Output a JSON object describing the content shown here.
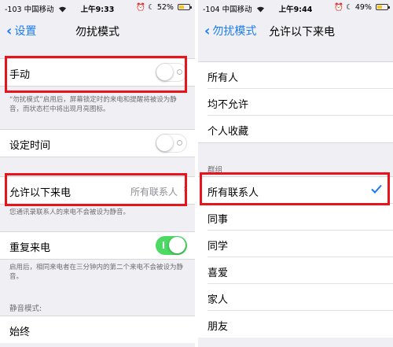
{
  "left": {
    "status": {
      "carrier": "-103 中国移动",
      "time": "上午9:33",
      "battery": "52%",
      "battery_level": 0.52
    },
    "nav": {
      "back": "设置",
      "title": "勿扰模式"
    },
    "manual": {
      "label": "手动",
      "on": false
    },
    "manual_note": "“勿扰模式”启用后，屏幕锁定时的来电和提醒将被设为静音，而状态栏中将出现月亮图标。",
    "scheduled": {
      "label": "设定时间",
      "on": false
    },
    "allow_calls": {
      "label": "允许以下来电",
      "value": "所有联系人"
    },
    "allow_note": "您通讯录联系人的来电不会被设为静音。",
    "repeated": {
      "label": "重复来电",
      "on": true
    },
    "repeated_note": "启用后，相同来电者在三分钟内的第二个来电不会被设为静音。",
    "silence_header": "静音模式:",
    "always": {
      "label": "始终"
    }
  },
  "right": {
    "status": {
      "carrier": "-104 中国移动",
      "time": "上午9:44",
      "battery": "49%",
      "battery_level": 0.49
    },
    "nav": {
      "back": "勿扰模式",
      "title": "允许以下来电"
    },
    "options": [
      "所有人",
      "均不允许",
      "个人收藏"
    ],
    "groups_header": "群组",
    "groups": [
      "所有联系人",
      "同事",
      "同学",
      "喜爱",
      "家人",
      "朋友"
    ],
    "selected": "所有联系人"
  },
  "colors": {
    "accent": "#1a7cf5",
    "toggle_on": "#4cd964",
    "highlight": "#e8141c",
    "battery": "#f5c518"
  },
  "icons": [
    "chevron-left-icon",
    "wifi-icon",
    "alarm-icon",
    "moon-icon",
    "battery-icon",
    "chevron-right-icon",
    "checkmark-icon"
  ]
}
